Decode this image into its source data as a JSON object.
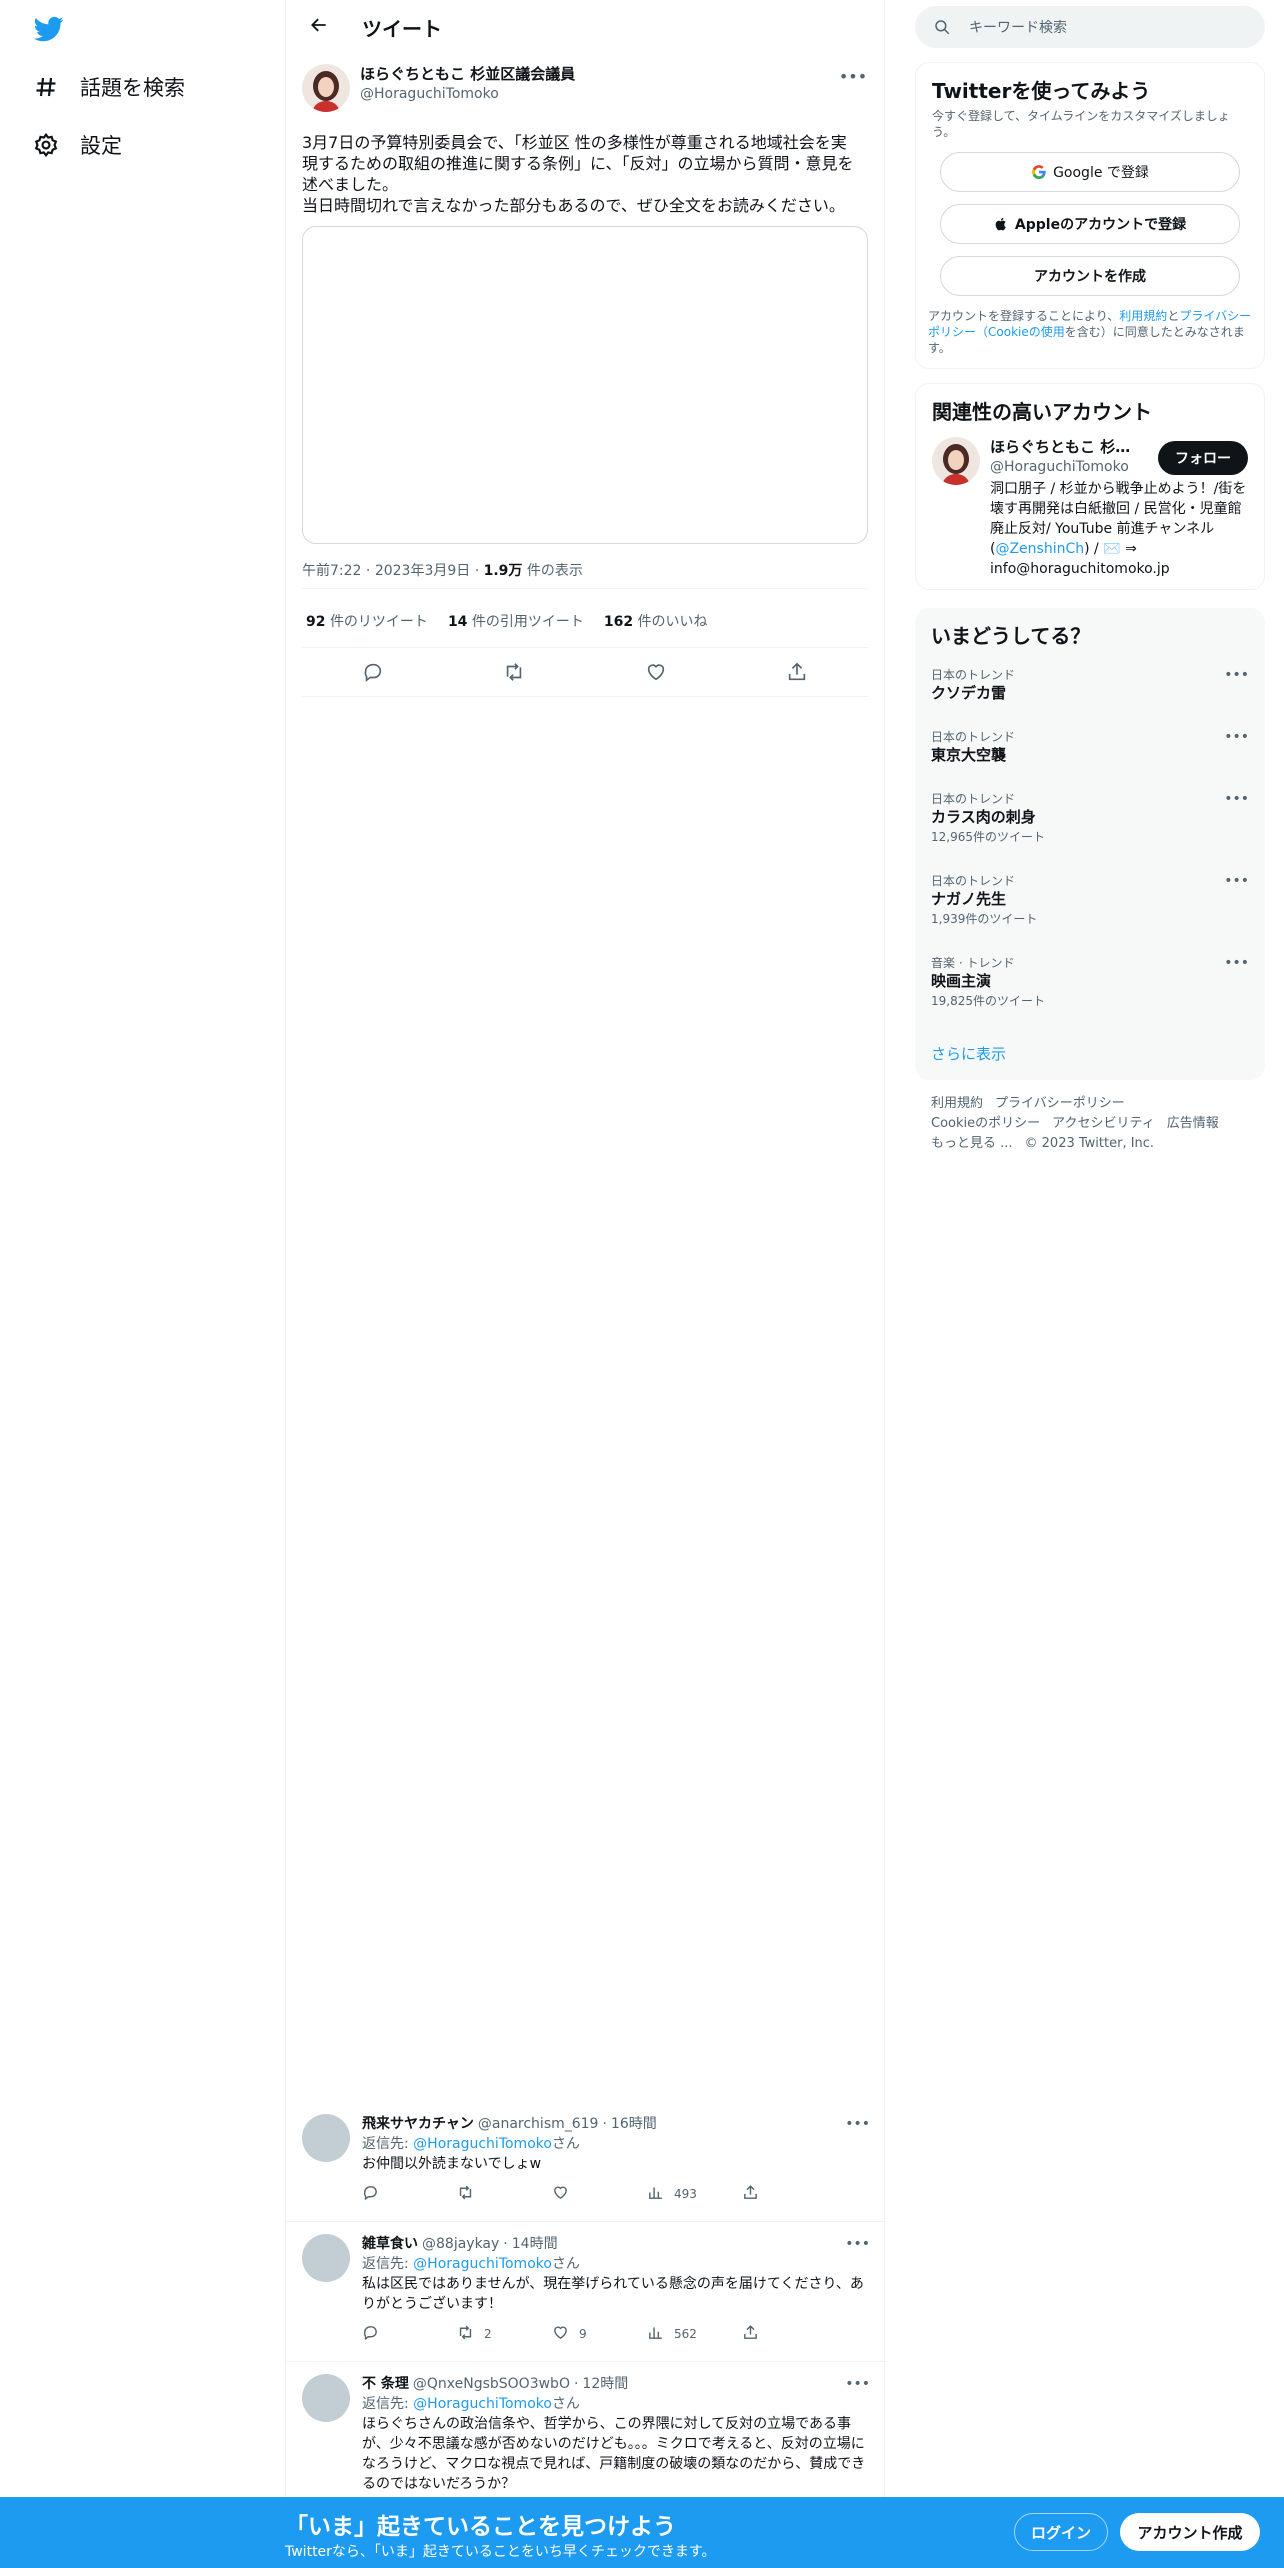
{
  "colors": {
    "brand": "#1d9bf0",
    "text": "#0f1419",
    "muted": "#536471",
    "border": "#eff3f4"
  },
  "nav": {
    "logo_icon": "twitter-bird-icon",
    "items": [
      {
        "icon": "hashtag-icon",
        "label": "話題を検索"
      },
      {
        "icon": "gear-icon",
        "label": "設定"
      }
    ]
  },
  "header": {
    "title": "ツイート",
    "back_icon": "arrow-left-icon"
  },
  "tweet": {
    "author_name": "ほらぐちともこ 杉並区議会議員",
    "author_handle": "@HoraguchiTomoko",
    "text": "3月7日の予算特別委員会で、「杉並区 性の多様性が尊重される地域社会を実現するための取組の推進に関する条例」に、「反対」の立場から質問・意見を述べました。\n当日時間切れで言えなかった部分もあるので、ぜひ全文をお読みください。",
    "time": "午前7:22",
    "date": "2023年3月9日",
    "views": "1.9万",
    "views_label": "件の表示",
    "retweets": "92",
    "retweets_label": "件のリツイート",
    "quotes": "14",
    "quotes_label": "件の引用ツイート",
    "likes": "162",
    "likes_label": "件のいいね"
  },
  "replies": [
    {
      "name": "飛来サヤカチャン",
      "handle": "@anarchism_619",
      "time": "16時間",
      "reply_prefix": "返信先: ",
      "reply_to": "@HoraguchiTomoko",
      "reply_suffix": "さん",
      "text": "お仲間以外読まないでしょw",
      "retweets": "",
      "likes": "",
      "views": "493"
    },
    {
      "name": "雑草食い",
      "handle": "@88jaykay",
      "time": "14時間",
      "reply_prefix": "返信先: ",
      "reply_to": "@HoraguchiTomoko",
      "reply_suffix": "さん",
      "text": "私は区民ではありませんが、現在挙げられている懸念の声を届けてくださり、ありがとうございます！",
      "retweets": "2",
      "likes": "9",
      "views": "562"
    },
    {
      "name": "不 条理",
      "handle": "@QnxeNgsbSOO3wbO",
      "time": "12時間",
      "reply_prefix": "返信先: ",
      "reply_to": "@HoraguchiTomoko",
      "reply_suffix": "さん",
      "text": "ほらぐちさんの政治信条や、哲学から、この界隈に対して反対の立場である事が、少々不思議な感が否めないのだけども。。。ミクロで考えると、反対の立場になろうけど、マクロな視点で見れば、戸籍制度の破壊の類なのだから、賛成できるのではないだろうか？",
      "retweets": "",
      "likes": "",
      "views": ""
    }
  ],
  "search": {
    "placeholder": "キーワード検索"
  },
  "signup": {
    "title": "Twitterを使ってみよう",
    "subtitle": "今すぐ登録して、タイムラインをカスタマイズしましょう。",
    "google_label": "Google で登録",
    "apple_label": "Appleのアカウントで登録",
    "create_label": "アカウントを作成",
    "legal_1": "アカウントを登録することにより、",
    "legal_terms": "利用規約",
    "legal_2": "と",
    "legal_privacy": "プライバシーポリシー（Cookieの使用",
    "legal_3": "を含む）に同意したとみなされます。"
  },
  "related": {
    "title": "関連性の高いアカウント",
    "name": "ほらぐちともこ 杉並区議会議員",
    "handle": "@HoraguchiTomoko",
    "follow_label": "フォロー",
    "bio_1": "洞口朋子 / 杉並から戦争止めよう！/街を壊す再開発は白紙撤回 / 民営化・児童館廃止反対/ YouTube 前進チャンネル(",
    "bio_link": "@ZenshinCh",
    "bio_2": ") / ✉️ ⇒ info@horaguchitomoko.jp"
  },
  "trends": {
    "title": "いまどうしてる？",
    "items": [
      {
        "context": "日本のトレンド",
        "name": "クソデカ雷",
        "count": ""
      },
      {
        "context": "日本のトレンド",
        "name": "東京大空襲",
        "count": ""
      },
      {
        "context": "日本のトレンド",
        "name": "カラス肉の刺身",
        "count": "12,965件のツイート"
      },
      {
        "context": "日本のトレンド",
        "name": "ナガノ先生",
        "count": "1,939件のツイート"
      },
      {
        "context": "音楽 · トレンド",
        "name": "映画主演",
        "count": "19,825件のツイート"
      }
    ],
    "show_more": "さらに表示"
  },
  "footer": {
    "links": [
      "利用規約",
      "プライバシーポリシー",
      "Cookieのポリシー",
      "アクセシビリティ",
      "広告情報",
      "もっと見る ..."
    ],
    "copyright": "© 2023 Twitter, Inc."
  },
  "banner": {
    "title": "「いま」起きていることを見つけよう",
    "subtitle": "Twitterなら、「いま」起きていることをいち早くチェックできます。",
    "login_label": "ログイン",
    "create_label": "アカウント作成"
  }
}
